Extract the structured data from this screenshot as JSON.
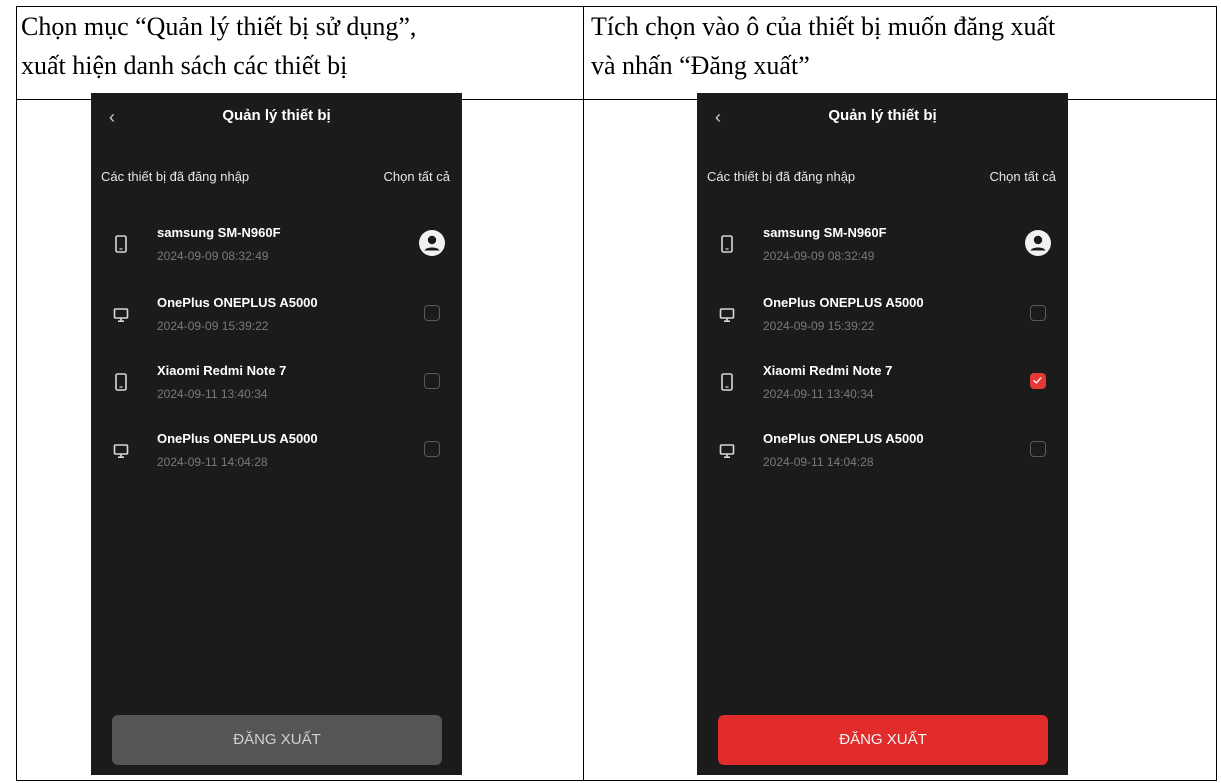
{
  "captions": {
    "left": [
      "Chọn mục “Quản lý thiết bị sử dụng”,",
      "xuất hiện danh sách các thiết bị"
    ],
    "right": [
      "Tích chọn vào ô của thiết bị muốn đăng xuất",
      "và nhấn “Đăng xuất”"
    ]
  },
  "screens": [
    {
      "title": "Quản lý thiết bị",
      "section_label": "Các thiết bị đã đăng nhập",
      "select_all_label": "Chọn tất cả",
      "devices": [
        {
          "name": "samsung SM-N960F",
          "time": "2024-09-09 08:32:49",
          "icon": "phone-icon",
          "state": "current"
        },
        {
          "name": "OnePlus ONEPLUS A5000",
          "time": "2024-09-09 15:39:22",
          "icon": "monitor-icon",
          "state": "unchecked"
        },
        {
          "name": "Xiaomi Redmi Note 7",
          "time": "2024-09-11 13:40:34",
          "icon": "phone-icon",
          "state": "unchecked"
        },
        {
          "name": "OnePlus ONEPLUS A5000",
          "time": "2024-09-11 14:04:28",
          "icon": "monitor-icon",
          "state": "unchecked"
        }
      ],
      "button_label": "ĐĂNG XUẤT",
      "button_state": "disabled",
      "button_color": "#555555"
    },
    {
      "title": "Quản lý thiết bị",
      "section_label": "Các thiết bị đã đăng nhập",
      "select_all_label": "Chọn tất cả",
      "devices": [
        {
          "name": "samsung SM-N960F",
          "time": "2024-09-09 08:32:49",
          "icon": "phone-icon",
          "state": "current"
        },
        {
          "name": "OnePlus ONEPLUS A5000",
          "time": "2024-09-09 15:39:22",
          "icon": "monitor-icon",
          "state": "unchecked"
        },
        {
          "name": "Xiaomi Redmi Note 7",
          "time": "2024-09-11 13:40:34",
          "icon": "phone-icon",
          "state": "checked"
        },
        {
          "name": "OnePlus ONEPLUS A5000",
          "time": "2024-09-11 14:04:28",
          "icon": "monitor-icon",
          "state": "unchecked"
        }
      ],
      "button_label": "ĐĂNG XUẤT",
      "button_state": "active",
      "button_color": "#e22b2b"
    }
  ]
}
